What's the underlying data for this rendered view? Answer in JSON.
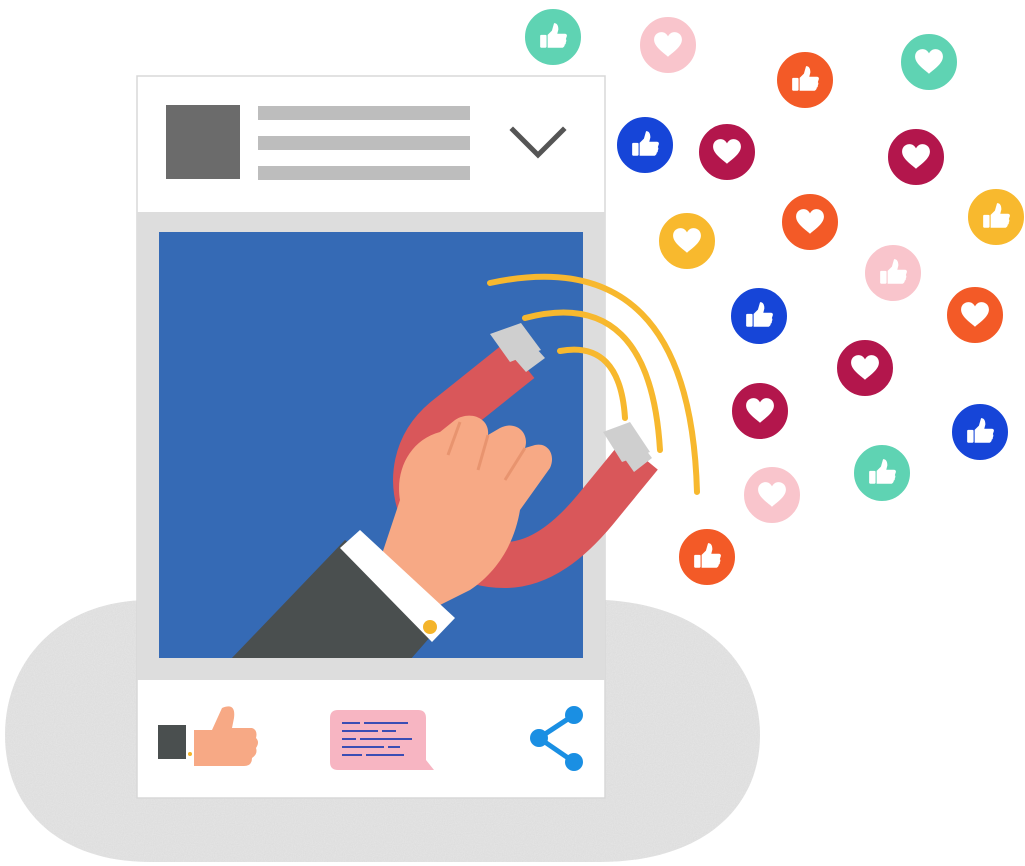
{
  "palette": {
    "post_background": "#ffffff",
    "post_border": "#d8d8d8",
    "header_placeholder": "#bdbdbd",
    "avatar_placeholder": "#6b6b6b",
    "chevron": "#555555",
    "frame_gray": "#dddddd",
    "image_blue": "#356ab5",
    "magnet_red": "#d9575a",
    "magnet_tip": "#cfcfcf",
    "signal_yellow": "#f7b82e",
    "skin": "#f7a985",
    "sleeve": "#4a4f4f",
    "cuff": "#ffffff",
    "cufflink": "#f4b42a",
    "comment_bubble": "#f7b5c2",
    "comment_lines": "#3b4db4",
    "share": "#1a8fe3",
    "blob": "#e6e6e6"
  },
  "reaction_types": {
    "like": "thumbs-up-icon",
    "love": "heart-icon"
  },
  "reaction_colors": [
    "#5fd3b3",
    "#f9c5cc",
    "#f35a27",
    "#1645d8",
    "#b3164c",
    "#f8b92e"
  ],
  "post": {
    "header": {
      "avatar": "avatar-placeholder",
      "text_lines": 3,
      "menu_icon": "chevron-down-icon"
    },
    "image": {
      "subject": "magnet-hand"
    },
    "actions": [
      {
        "name": "like",
        "icon": "thumbs-up-icon"
      },
      {
        "name": "comment",
        "icon": "comment-icon"
      },
      {
        "name": "share",
        "icon": "share-icon"
      }
    ]
  }
}
